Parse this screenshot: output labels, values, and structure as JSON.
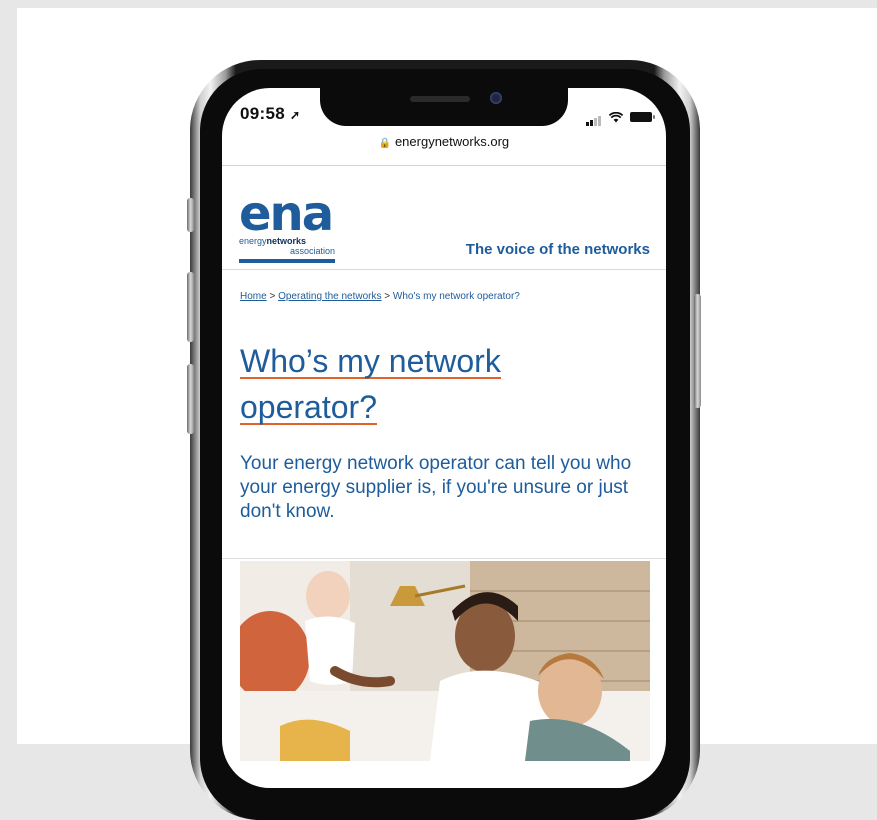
{
  "status_bar": {
    "time": "09:58",
    "location_glyph": "➚"
  },
  "browser": {
    "url": "energynetworks.org",
    "lock_glyph": "🔒"
  },
  "logo": {
    "wordmark": "ena",
    "line1_plain": "energy",
    "line1_bold": "networks",
    "line2": "association"
  },
  "tagline": "The voice of the networks",
  "breadcrumb": {
    "home": "Home",
    "sep": ">",
    "section": "Operating the networks",
    "current": "Who's my network operator?"
  },
  "page": {
    "heading_line1": "Who’s my network",
    "heading_line2": "operator?",
    "lede": "Your energy network operator can tell you who your energy supplier is, if you're unsure or just don't know."
  },
  "colors": {
    "brand_blue": "#1e5c9b",
    "accent_orange": "#e2622b"
  }
}
